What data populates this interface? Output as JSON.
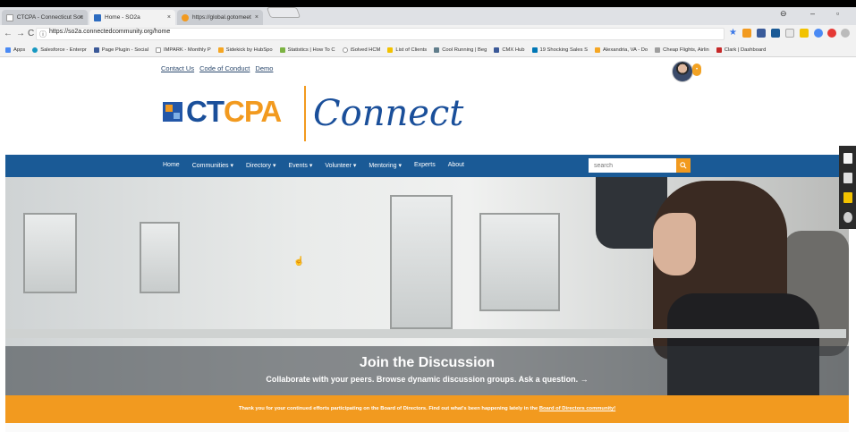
{
  "browser": {
    "tabs": [
      {
        "title": "CTCPA - Connecticut Soc",
        "favicon_color": "#ffffff",
        "active": false
      },
      {
        "title": "Home - SO2a",
        "favicon_color": "#2d6cc0",
        "active": true
      },
      {
        "title": "https://global.gotomeet",
        "favicon_color": "#f29a1f",
        "active": false
      }
    ],
    "close_glyph": "×",
    "window_controls": {
      "profile": "⊖",
      "minimize": "–",
      "restore": "▫"
    },
    "nav": {
      "back": "←",
      "forward": "→",
      "reload": "C",
      "info": "ⓘ"
    },
    "url": "https://so2a.connectedcommunity.org/home",
    "star": "★"
  },
  "bookmarks": [
    {
      "label": "Apps",
      "icon_color": "#4a8af4"
    },
    {
      "label": "Salesforce - Enterpr",
      "icon_color": "#1798c1"
    },
    {
      "label": "Page Plugin - Social",
      "icon_color": "#3b5998"
    },
    {
      "label": "IMPARK - Monthly P",
      "icon_color": "#cccccc"
    },
    {
      "label": "Sidekick by HubSpo",
      "icon_color": "#f5a623"
    },
    {
      "label": "Statistics | How To C",
      "icon_color": "#7cb342"
    },
    {
      "label": "iSolved HCM",
      "icon_color": "#e0e0e0"
    },
    {
      "label": "List of Clients",
      "icon_color": "#f2c200"
    },
    {
      "label": "Cool Running | Beg",
      "icon_color": "#607d8b"
    },
    {
      "label": "CMX Hub",
      "icon_color": "#3b5998"
    },
    {
      "label": "19 Shocking Sales S",
      "icon_color": "#0077b5"
    },
    {
      "label": "Alexandria, VA - Do",
      "icon_color": "#f5a623"
    },
    {
      "label": "Cheap Flights, Airlin",
      "icon_color": "#9e9e9e"
    },
    {
      "label": "Clark | Dashboard",
      "icon_color": "#c62828"
    }
  ],
  "site": {
    "util_links": [
      "Contact Us",
      "Code of Conduct",
      "Demo"
    ],
    "avatar_badge": "•",
    "logo": {
      "ct": "CT",
      "cpa": "CPA",
      "connect": "Connect"
    },
    "nav": [
      "Home",
      "Communities ▾",
      "Directory ▾",
      "Events ▾",
      "Volunteer ▾",
      "Mentoring ▾",
      "Experts",
      "About"
    ],
    "search_placeholder": "search",
    "hero": {
      "title": "Join the Discussion",
      "subtitle": "Collaborate with your peers. Browse dynamic discussion groups. Ask a question. →"
    },
    "announcement": {
      "text": "Thank you for your continued efforts participating on the Board of Directors. Find out what's been happening lately in the ",
      "link": "Board of Directors community!"
    }
  },
  "colors": {
    "brand_blue": "#1a5a96",
    "brand_orange": "#f29a1f",
    "logo_blue": "#1a4f9a"
  }
}
